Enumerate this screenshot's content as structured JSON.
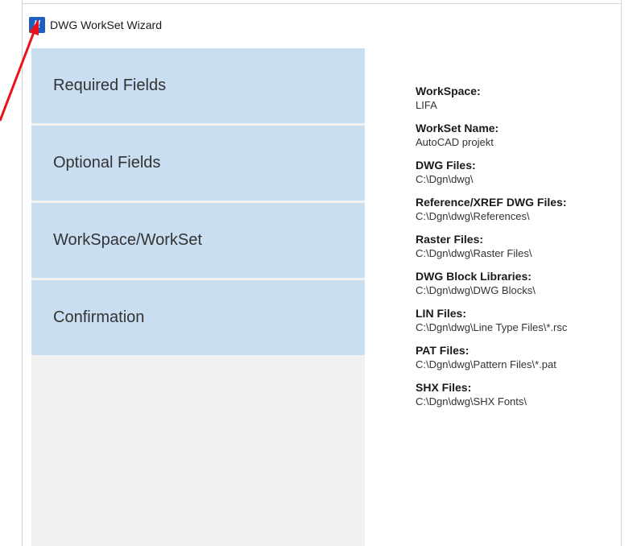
{
  "window": {
    "title": "DWG WorkSet Wizard",
    "icon": "microstation-app-icon"
  },
  "sidebar": {
    "steps": [
      {
        "label": "Required Fields"
      },
      {
        "label": "Optional Fields"
      },
      {
        "label": "WorkSpace/WorkSet"
      },
      {
        "label": "Confirmation"
      }
    ]
  },
  "summary": {
    "fields": [
      {
        "label": "WorkSpace:",
        "value": "LIFA"
      },
      {
        "label": "WorkSet Name:",
        "value": "AutoCAD projekt"
      },
      {
        "label": "DWG Files:",
        "value": "C:\\Dgn\\dwg\\"
      },
      {
        "label": "Reference/XREF DWG Files:",
        "value": "C:\\Dgn\\dwg\\References\\"
      },
      {
        "label": "Raster Files:",
        "value": "C:\\Dgn\\dwg\\Raster Files\\"
      },
      {
        "label": "DWG Block Libraries:",
        "value": "C:\\Dgn\\dwg\\DWG Blocks\\"
      },
      {
        "label": "LIN Files:",
        "value": "C:\\Dgn\\dwg\\Line Type Files\\*.rsc"
      },
      {
        "label": "PAT Files:",
        "value": "C:\\Dgn\\dwg\\Pattern Files\\*.pat"
      },
      {
        "label": "SHX Files:",
        "value": "C:\\Dgn\\dwg\\SHX Fonts\\"
      }
    ]
  },
  "colors": {
    "step_background": "#c9def1",
    "sidebar_background": "#f1f1f1",
    "annotation_arrow": "#e8141c",
    "app_icon": "#1f5fbf"
  }
}
